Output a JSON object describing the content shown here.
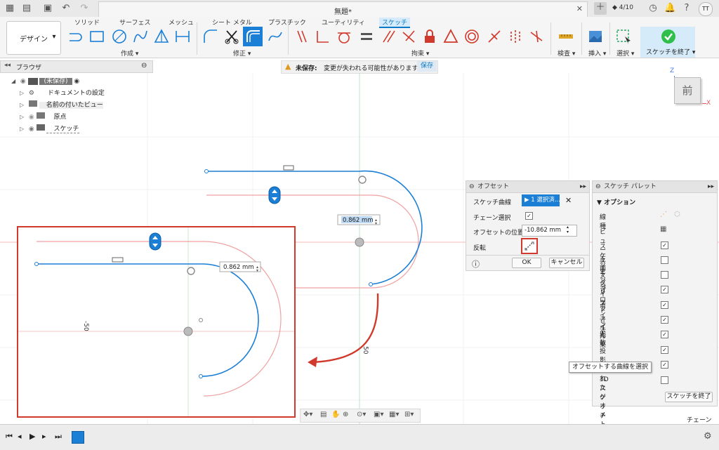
{
  "title_bar": {
    "doc_title": "無題*",
    "job_count": "4/10",
    "user_initials": "TT"
  },
  "ribbon": {
    "workspace": "デザイン",
    "tabs": [
      "ソリッド",
      "サーフェス",
      "メッシュ",
      "シート メタル",
      "プラスチック",
      "ユーティリティ",
      "スケッチ"
    ],
    "groups": {
      "create": "作成",
      "modify": "修正",
      "constraints": "拘束",
      "inspect": "検査",
      "insert": "挿入",
      "select": "選択",
      "finish": "スケッチを終了"
    }
  },
  "browser": {
    "title": "ブラウザ",
    "root": "(未保存)",
    "items": [
      "ドキュメントの設定",
      "名前の付いたビュー",
      "原点",
      "スケッチ"
    ]
  },
  "warning": {
    "label": "未保存:",
    "message": "変更が失われる可能性があります",
    "save": "保存"
  },
  "viewcube": {
    "face": "前",
    "axis_z": "Z",
    "axis_x": "X"
  },
  "canvas": {
    "dim_value": "0.862 mm",
    "inset_dim_value": "0.862 mm",
    "dim_text_vertical": "-50",
    "dim_text_50": "50"
  },
  "offset_panel": {
    "title": "オフセット",
    "sketch_curve_label": "スケッチ曲線",
    "selection_button": "1 選択済...",
    "chain_label": "チェーン選択",
    "position_label": "オフセットの位置",
    "position_value": "-10.862 mm",
    "flip_label": "反転",
    "ok": "OK",
    "cancel": "キャンセル"
  },
  "sketch_palette": {
    "title": "スケッチ パレット",
    "section": "オプション",
    "items": [
      {
        "label": "線種",
        "type": "icon"
      },
      {
        "label": "ビュー正面",
        "type": "icon"
      },
      {
        "label": "スケッチ グリッド",
        "checked": true
      },
      {
        "label": "スナップ",
        "checked": false
      },
      {
        "label": "スライス",
        "checked": false
      },
      {
        "label": "プロファイル",
        "checked": true
      },
      {
        "label": "ポイント数",
        "checked": true
      },
      {
        "label": "寸法",
        "checked": true
      },
      {
        "label": "拘束",
        "checked": true
      },
      {
        "label": "投影されたジオメトリ",
        "checked": true
      },
      {
        "label": "",
        "checked": true
      },
      {
        "label": "3D スケッチ",
        "checked": false
      }
    ],
    "finish": "スケッチを終了"
  },
  "tooltip": "オフセットする曲線を選択",
  "status": {
    "mode": "チェーン"
  },
  "colors": {
    "accent": "#0a7ac6",
    "sketch_blue": "#1b7fd6",
    "offset_pink": "#f0a0a0",
    "callout_red": "#d0392b"
  }
}
